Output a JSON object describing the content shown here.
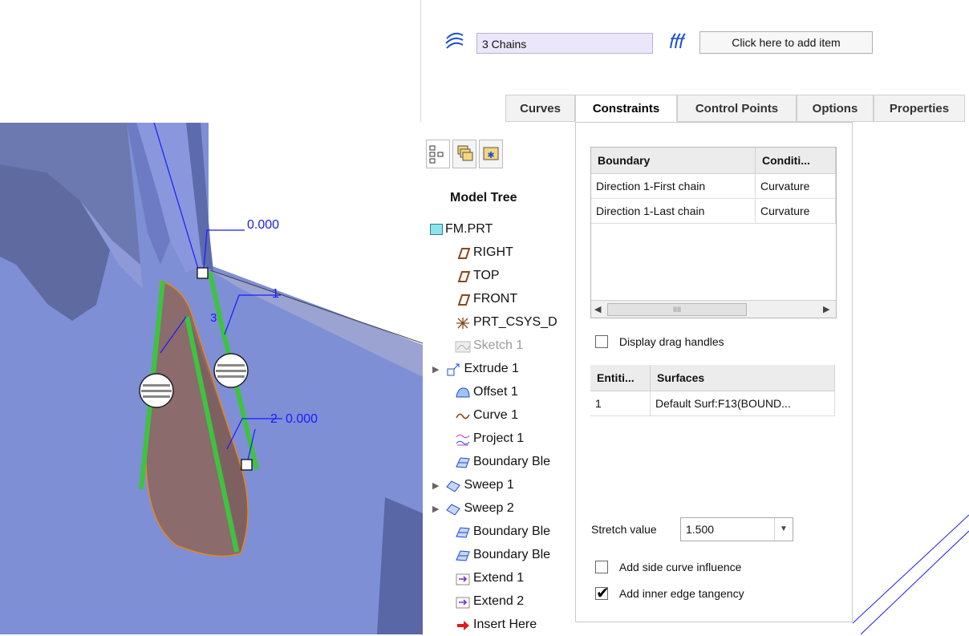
{
  "dashboard": {
    "chains_value": "3 Chains",
    "add_item_label": "Click here to add item",
    "tabs": [
      "Curves",
      "Constraints",
      "Control Points",
      "Options",
      "Properties"
    ]
  },
  "model_tree": {
    "title": "Model Tree",
    "items": [
      "FM.PRT",
      "RIGHT",
      "TOP",
      "FRONT",
      "PRT_CSYS_D",
      "Sketch 1",
      "Extrude 1",
      "Offset 1",
      "Curve 1",
      "Project 1",
      "Boundary Ble",
      "Sweep 1",
      "Sweep 2",
      "Boundary Ble",
      "Boundary Ble",
      "Extend 1",
      "Extend 2",
      "Insert Here"
    ]
  },
  "constraints": {
    "boundary_table": {
      "headers": [
        "Boundary",
        "Conditi..."
      ],
      "rows": [
        [
          "Direction 1-First chain",
          "Curvature"
        ],
        [
          "Direction 1-Last chain",
          "Curvature"
        ]
      ]
    },
    "display_drag_handles": "Display drag handles",
    "surfaces_table": {
      "headers": [
        "Entiti...",
        "Surfaces"
      ],
      "rows": [
        [
          "1",
          "Default Surf:F13(BOUND..."
        ]
      ]
    },
    "stretch_label": "Stretch value",
    "stretch_value": "1.500",
    "add_side_curve": "Add side curve influence",
    "add_inner_edge": "Add inner edge tangency",
    "add_inner_edge_checked": true
  },
  "viewport": {
    "dim_top": "0.000",
    "dim_mid": "0.000",
    "chain_1": "1",
    "chain_2": "2",
    "chain_3": "3"
  },
  "colors": {
    "surface_blue": "#7e8fd6",
    "boundary_green": "#3ec341",
    "dim_blue": "#1a1aff",
    "edge_orange": "#e7861a"
  }
}
